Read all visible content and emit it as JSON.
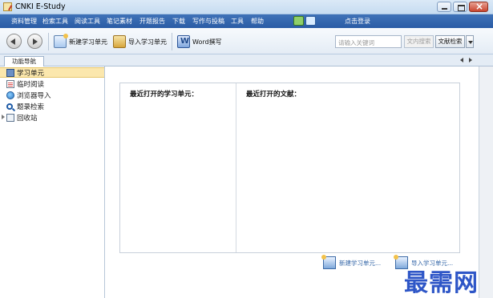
{
  "window": {
    "title": "CNKI E-Study"
  },
  "menubar": {
    "items": [
      "资料管理",
      "检索工具",
      "阅读工具",
      "笔记素材",
      "开题报告",
      "下载",
      "写作与投稿",
      "工具",
      "帮助"
    ],
    "login": "点击登录"
  },
  "toolbar": {
    "new_unit": "新建学习单元",
    "import_unit": "导入学习单元",
    "word_write": "Word撰写",
    "search_placeholder": "请输入关键词",
    "search_button": "文内搜索",
    "doc_search": "文献检索"
  },
  "tabs": {
    "nav": "功能导航"
  },
  "sidebar": {
    "items": [
      "学习单元",
      "临时阅读",
      "浏览器导入",
      "题录检索",
      "回收站"
    ]
  },
  "main": {
    "recent_units": "最近打开的学习单元：",
    "recent_docs": "最近打开的文献：",
    "link_new_unit": "新建学习单元...",
    "link_second": "导入学习单元..."
  },
  "watermark": "最需网"
}
